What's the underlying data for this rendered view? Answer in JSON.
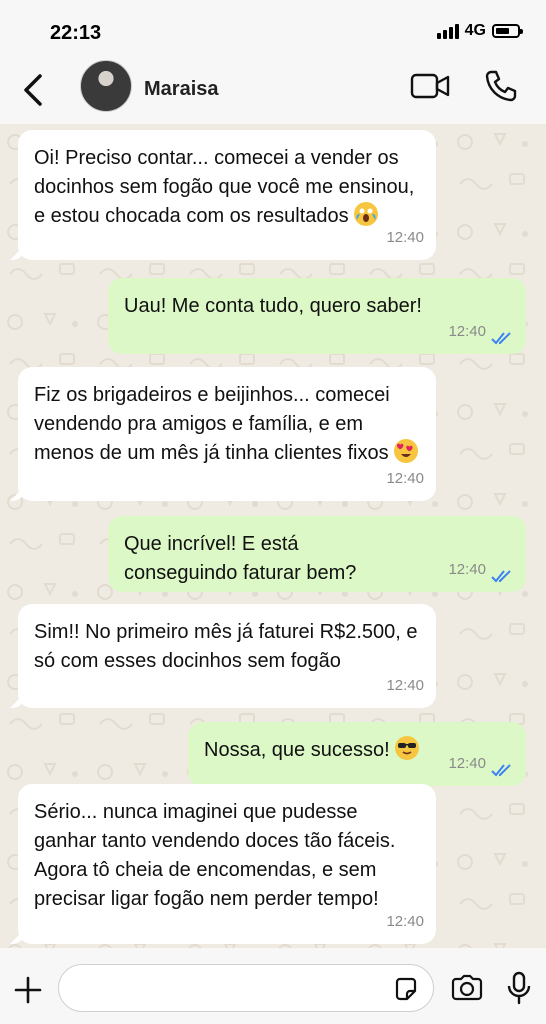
{
  "status_bar": {
    "time": "22:13",
    "network": "4G"
  },
  "header": {
    "contact_name": "Maraisa"
  },
  "messages": [
    {
      "direction": "in",
      "text": "Oi! Preciso contar... comecei a vender os docinhos sem fogão que você me ensinou, e estou chocada com os resultados",
      "emoji": "screaming-face-emoji",
      "time": "12:40"
    },
    {
      "direction": "out",
      "text": "Uau! Me conta tudo, quero saber!",
      "time": "12:40",
      "status": "read"
    },
    {
      "direction": "in",
      "text": "Fiz os brigadeiros e beijinhos... comecei vendendo pra amigos e família, e em menos de um mês já tinha clientes fixos",
      "emoji": "heart-eyes-emoji",
      "time": "12:40"
    },
    {
      "direction": "out",
      "text": "Que incrível! E está conseguindo faturar bem?",
      "time": "12:40",
      "status": "read"
    },
    {
      "direction": "in",
      "text": "Sim!! No primeiro mês já faturei R$2.500, e só com esses docinhos sem fogão",
      "time": "12:40"
    },
    {
      "direction": "out",
      "text": "Nossa, que sucesso!",
      "emoji": "sunglasses-emoji",
      "time": "12:40",
      "status": "read"
    },
    {
      "direction": "in",
      "text": "Sério... nunca imaginei que pudesse ganhar tanto vendendo doces tão fáceis. Agora tô cheia de encomendas, e sem precisar ligar fogão nem perder tempo!",
      "time": "12:40"
    }
  ],
  "composer": {
    "value": "",
    "placeholder": ""
  },
  "colors": {
    "incoming_bubble": "#ffffff",
    "outgoing_bubble": "#dcf8c6",
    "chat_background": "#efeae2",
    "read_ticks": "#3b82f6"
  }
}
